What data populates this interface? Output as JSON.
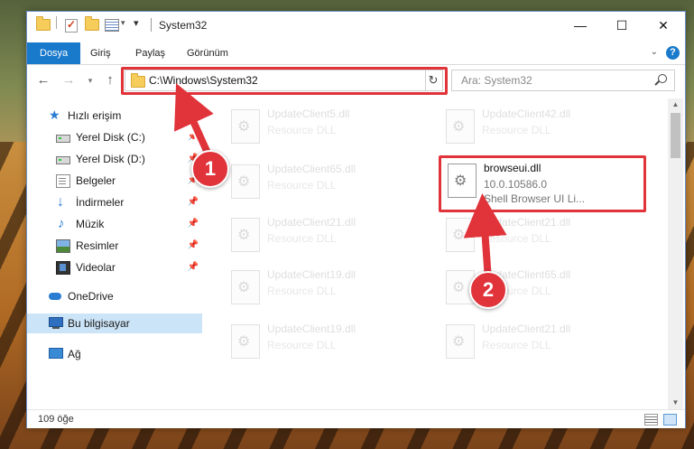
{
  "window": {
    "title": "System32",
    "minimize": "—",
    "maximize": "☐",
    "close": "✕"
  },
  "ribbon": {
    "tabs": [
      {
        "label": "Dosya",
        "active": true
      },
      {
        "label": "Giriş"
      },
      {
        "label": "Paylaş"
      },
      {
        "label": "Görünüm"
      }
    ],
    "help": "?"
  },
  "address": {
    "path": "C:\\Windows\\System32",
    "search_placeholder": "Ara: System32"
  },
  "sidebar": {
    "items": [
      {
        "label": "Hızlı erişim",
        "icon": "star-icon"
      },
      {
        "label": "Yerel Disk (C:)",
        "icon": "drive-icon",
        "pinned": true
      },
      {
        "label": "Yerel Disk (D:)",
        "icon": "drive-icon",
        "pinned": true
      },
      {
        "label": "Belgeler",
        "icon": "documents-icon",
        "pinned": true
      },
      {
        "label": "İndirmeler",
        "icon": "downloads-icon",
        "pinned": true
      },
      {
        "label": "Müzik",
        "icon": "music-icon",
        "pinned": true
      },
      {
        "label": "Resimler",
        "icon": "pictures-icon",
        "pinned": true
      },
      {
        "label": "Videolar",
        "icon": "videos-icon",
        "pinned": true
      },
      {
        "label": "OneDrive",
        "icon": "onedrive-icon"
      },
      {
        "label": "Bu bilgisayar",
        "icon": "this-pc-icon",
        "selected": true
      },
      {
        "label": "Ağ",
        "icon": "network-icon"
      }
    ]
  },
  "files": [
    {
      "name": "UpdateClient5.dll",
      "desc": "Resource DLL"
    },
    {
      "name": "UpdateClient42.dll",
      "desc": "Resource DLL"
    },
    {
      "name": "UpdateClient65.dll",
      "desc": "Resource DLL"
    },
    {
      "name": "browseui.dll",
      "version": "10.0.10586.0",
      "desc": "Shell Browser UI Li..."
    },
    {
      "name": "UpdateClient21.dll",
      "desc": "Resource DLL"
    },
    {
      "name": "UpdateClient21.dll",
      "desc": "Resource DLL"
    },
    {
      "name": "UpdateClient19.dll",
      "desc": "Resource DLL"
    },
    {
      "name": "UpdateClient65.dll",
      "desc": "Resource DLL"
    },
    {
      "name": "UpdateClient19.dll",
      "desc": "Resource DLL"
    },
    {
      "name": "UpdateClient21.dll",
      "desc": "Resource DLL"
    }
  ],
  "status": {
    "item_count": "109 öğe"
  },
  "annotations": {
    "marker1": "1",
    "marker2": "2",
    "color": "#e0333a"
  }
}
